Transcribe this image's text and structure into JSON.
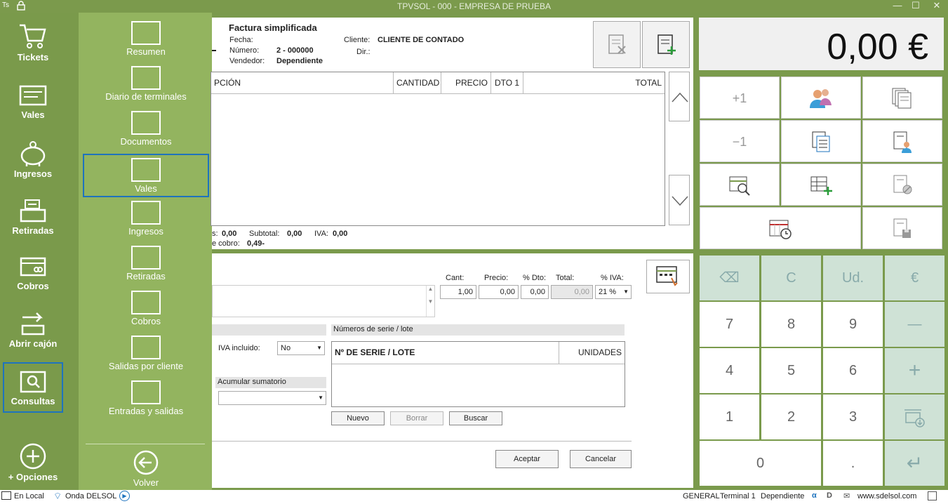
{
  "window": {
    "title": "TPVSOL - 000 - EMPRESA DE PRUEBA",
    "app_badge": "Ts"
  },
  "nav": {
    "items": [
      {
        "label": "Tickets"
      },
      {
        "label": "Vales"
      },
      {
        "label": "Ingresos"
      },
      {
        "label": "Retiradas"
      },
      {
        "label": "Cobros"
      },
      {
        "label": "Abrir cajón"
      },
      {
        "label": "Consultas"
      }
    ],
    "options_label": "+ Opciones"
  },
  "submenu": {
    "items": [
      {
        "label": "Resumen"
      },
      {
        "label": "Diario de terminales"
      },
      {
        "label": "Documentos"
      },
      {
        "label": "Vales"
      },
      {
        "label": "Ingresos"
      },
      {
        "label": "Retiradas"
      },
      {
        "label": "Cobros"
      },
      {
        "label": "Salidas por cliente"
      },
      {
        "label": "Entradas y salidas"
      }
    ],
    "back_label": "Volver"
  },
  "doc": {
    "type": "Factura simplificada",
    "fecha_label": "Fecha:",
    "fecha": "",
    "numero_label": "Número:",
    "numero": "2 - 000000",
    "vendedor_label": "Vendedor:",
    "vendedor": "Dependiente",
    "cliente_label": "Cliente:",
    "cliente": "CLIENTE DE CONTADO",
    "dir_label": "Dir.:",
    "dir": ""
  },
  "lines_table": {
    "headers": {
      "descripcion": "PCIÓN",
      "cantidad": "CANTIDAD",
      "precio": "PRECIO",
      "dto": "DTO 1",
      "total": "TOTAL"
    }
  },
  "totals": {
    "left_label": "s:",
    "left_value": "0,00",
    "subtotal_label": "Subtotal:",
    "subtotal": "0,00",
    "iva_label": "IVA:",
    "iva": "0,00",
    "cobro_label": "e cobro:",
    "cobro": "0,49-"
  },
  "line_edit": {
    "cant_label": "Cant:",
    "cant": "1,00",
    "precio_label": "Precio:",
    "precio": "0,00",
    "dto_label": "% Dto:",
    "dto": "0,00",
    "total_label": "Total:",
    "total": "0,00",
    "iva_label": "% IVA:",
    "iva": "21 %",
    "iva_incluido_label": "IVA incluido:",
    "iva_incluido": "No",
    "acumular_label": "Acumular sumatorio",
    "acumular": "",
    "serie_section": "Números de serie / lote",
    "serie_headers": {
      "serie": "Nº DE SERIE / LOTE",
      "unidades": "UNIDADES"
    },
    "nuevo": "Nuevo",
    "borrar": "Borrar",
    "buscar": "Buscar",
    "aceptar": "Aceptar",
    "cancelar": "Cancelar"
  },
  "total_display": "0,00 €",
  "function_keys": {
    "plus_one": "+1",
    "minus_one": "−1"
  },
  "keypad": {
    "backspace": "⌫",
    "clear": "C",
    "units": "Ud.",
    "euro": "€",
    "k7": "7",
    "k8": "8",
    "k9": "9",
    "minus": "—",
    "k4": "4",
    "k5": "5",
    "k6": "6",
    "plus": "+",
    "k1": "1",
    "k2": "2",
    "k3": "3",
    "k0": "0",
    "dot": ".",
    "enter": "↵"
  },
  "status": {
    "local": "En Local",
    "onda": "Onda DELSOL",
    "general": "GENERAL",
    "terminal": "Terminal 1",
    "user": "Dependiente",
    "web": "www.sdelsol.com"
  },
  "colors": {
    "nav": "#7a9a4b",
    "submenu": "#93b45f",
    "selection": "#1e73be",
    "keypad_accent": "#cfe2d6"
  }
}
